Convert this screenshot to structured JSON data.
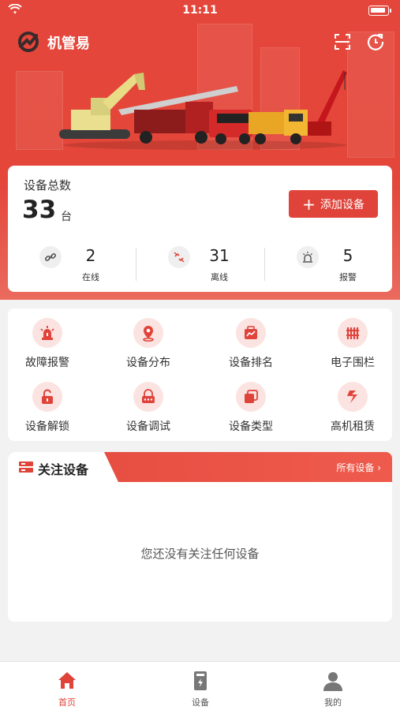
{
  "status_bar": {
    "time": "11:11"
  },
  "header": {
    "app_title": "机管易"
  },
  "summary": {
    "label": "设备总数",
    "total": "33",
    "unit": "台",
    "add_button": "添加设备",
    "stats": [
      {
        "value": "2",
        "label": "在线",
        "icon": "link-icon"
      },
      {
        "value": "31",
        "label": "离线",
        "icon": "broken-link-icon"
      },
      {
        "value": "5",
        "label": "报警",
        "icon": "alarm-light-icon"
      }
    ]
  },
  "functions": [
    {
      "label": "故障报警",
      "icon": "alarm-siren-icon"
    },
    {
      "label": "设备分布",
      "icon": "location-pin-icon"
    },
    {
      "label": "设备排名",
      "icon": "ranking-icon"
    },
    {
      "label": "电子围栏",
      "icon": "fence-icon"
    },
    {
      "label": "设备解锁",
      "icon": "unlock-icon"
    },
    {
      "label": "设备调试",
      "icon": "debug-icon"
    },
    {
      "label": "设备类型",
      "icon": "device-type-icon"
    },
    {
      "label": "高机租赁",
      "icon": "rental-icon"
    }
  ],
  "follow": {
    "title": "关注设备",
    "all_link": "所有设备 ›",
    "empty_text": "您还没有关注任何设备"
  },
  "bottom_nav": [
    {
      "label": "首页",
      "icon": "home-icon",
      "active": true
    },
    {
      "label": "设备",
      "icon": "device-icon",
      "active": false
    },
    {
      "label": "我的",
      "icon": "user-icon",
      "active": false
    }
  ],
  "colors": {
    "primary": "#e0433a",
    "icon_bg": "#fbe3e1"
  }
}
